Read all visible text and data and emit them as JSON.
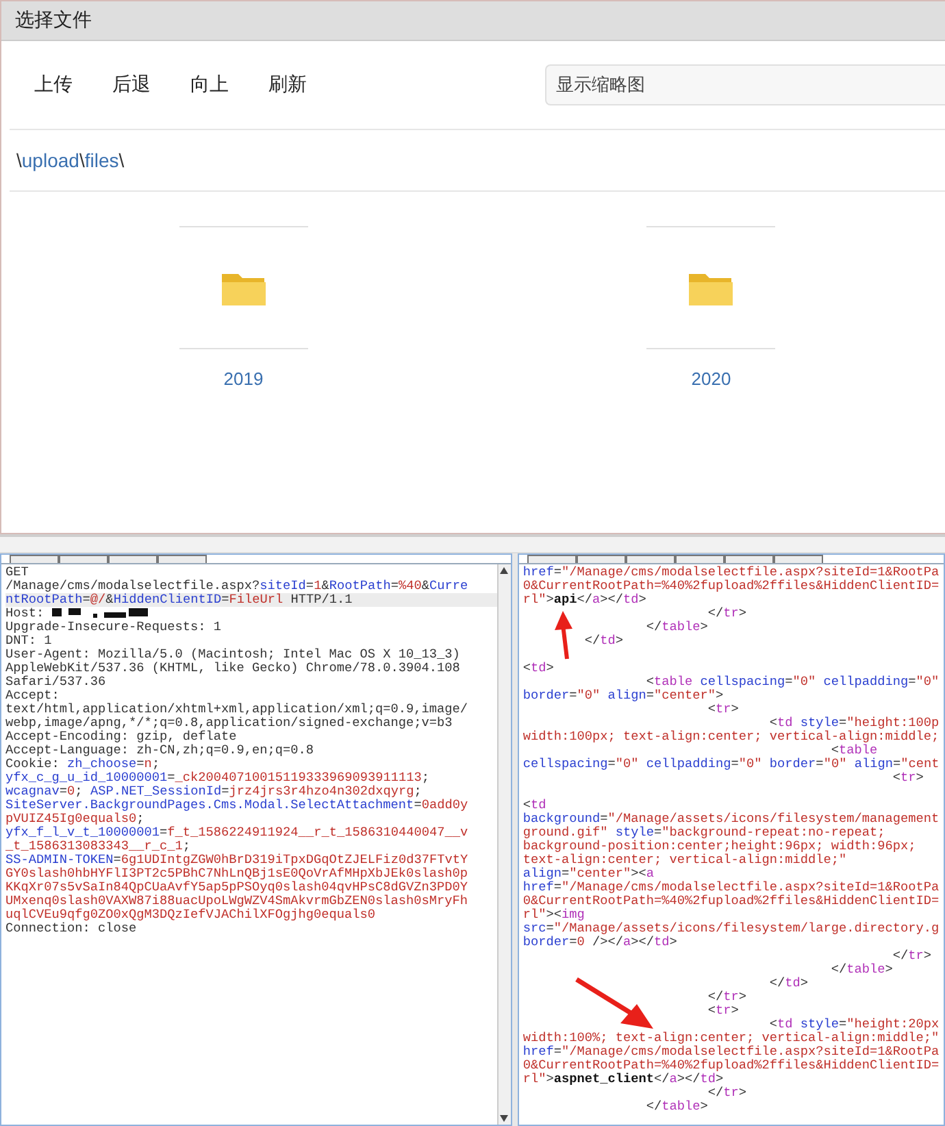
{
  "dialog": {
    "title": "选择文件",
    "toolbar": [
      "上传",
      "后退",
      "向上",
      "刷新"
    ],
    "view_select": {
      "value": "显示缩略图"
    },
    "breadcrumb": [
      {
        "kind": "sep",
        "text": "\\"
      },
      {
        "kind": "link",
        "text": "upload"
      },
      {
        "kind": "sep",
        "text": "\\"
      },
      {
        "kind": "link",
        "text": "files"
      },
      {
        "kind": "sep",
        "text": "\\"
      }
    ],
    "folders": [
      {
        "name": "2019"
      },
      {
        "name": "2020"
      }
    ]
  },
  "request": {
    "lines": [
      {
        "highlighted": false,
        "parts": [
          {
            "kind": "plain",
            "t": "GET"
          }
        ]
      },
      {
        "highlighted": false,
        "parts": [
          {
            "kind": "plain",
            "t": "/Manage/cms/modalselectfile.aspx?"
          },
          {
            "kind": "name",
            "t": "siteId"
          },
          {
            "kind": "plain",
            "t": "="
          },
          {
            "kind": "value",
            "t": "1"
          },
          {
            "kind": "plain",
            "t": "&"
          },
          {
            "kind": "name",
            "t": "RootPath"
          },
          {
            "kind": "plain",
            "t": "="
          },
          {
            "kind": "value",
            "t": "%40"
          },
          {
            "kind": "plain",
            "t": "&"
          },
          {
            "kind": "name",
            "t": "Curre"
          }
        ]
      },
      {
        "highlighted": true,
        "parts": [
          {
            "kind": "name",
            "t": "ntRootPath"
          },
          {
            "kind": "plain",
            "t": "="
          },
          {
            "kind": "value",
            "t": "@/"
          },
          {
            "kind": "plain",
            "t": "&"
          },
          {
            "kind": "name",
            "t": "HiddenClientID"
          },
          {
            "kind": "plain",
            "t": "="
          },
          {
            "kind": "value",
            "t": "FileUrl"
          },
          {
            "kind": "plain",
            "t": " HTTP/1.1"
          }
        ]
      },
      {
        "highlighted": false,
        "parts": [
          {
            "kind": "plain",
            "t": "Host:"
          },
          {
            "kind": "redacted"
          }
        ]
      },
      {
        "highlighted": false,
        "parts": [
          {
            "kind": "plain",
            "t": "Upgrade-Insecure-Requests: 1"
          }
        ]
      },
      {
        "highlighted": false,
        "parts": [
          {
            "kind": "plain",
            "t": "DNT: 1"
          }
        ]
      },
      {
        "highlighted": false,
        "parts": [
          {
            "kind": "plain",
            "t": "User-Agent: Mozilla/5.0 (Macintosh; Intel Mac OS X 10_13_3)"
          }
        ]
      },
      {
        "highlighted": false,
        "parts": [
          {
            "kind": "plain",
            "t": "AppleWebKit/537.36 (KHTML, like Gecko) Chrome/78.0.3904.108"
          }
        ]
      },
      {
        "highlighted": false,
        "parts": [
          {
            "kind": "plain",
            "t": "Safari/537.36"
          }
        ]
      },
      {
        "highlighted": false,
        "parts": [
          {
            "kind": "plain",
            "t": "Accept:"
          }
        ]
      },
      {
        "highlighted": false,
        "parts": [
          {
            "kind": "plain",
            "t": "text/html,application/xhtml+xml,application/xml;q=0.9,image/"
          }
        ]
      },
      {
        "highlighted": false,
        "parts": [
          {
            "kind": "plain",
            "t": "webp,image/apng,*/*;q=0.8,application/signed-exchange;v=b3"
          }
        ]
      },
      {
        "highlighted": false,
        "parts": [
          {
            "kind": "plain",
            "t": "Accept-Encoding: gzip, deflate"
          }
        ]
      },
      {
        "highlighted": false,
        "parts": [
          {
            "kind": "plain",
            "t": "Accept-Language: zh-CN,zh;q=0.9,en;q=0.8"
          }
        ]
      },
      {
        "highlighted": false,
        "parts": [
          {
            "kind": "plain",
            "t": "Cookie: "
          },
          {
            "kind": "name",
            "t": "zh_choose"
          },
          {
            "kind": "plain",
            "t": "="
          },
          {
            "kind": "value",
            "t": "n"
          },
          {
            "kind": "plain",
            "t": ";"
          }
        ]
      },
      {
        "highlighted": false,
        "parts": [
          {
            "kind": "name",
            "t": "yfx_c_g_u_id_10000001"
          },
          {
            "kind": "plain",
            "t": "="
          },
          {
            "kind": "value",
            "t": "_ck20040710015119333969093911113"
          },
          {
            "kind": "plain",
            "t": ";"
          }
        ]
      },
      {
        "highlighted": false,
        "parts": [
          {
            "kind": "name",
            "t": "wcagnav"
          },
          {
            "kind": "plain",
            "t": "="
          },
          {
            "kind": "value",
            "t": "0"
          },
          {
            "kind": "plain",
            "t": "; "
          },
          {
            "kind": "name",
            "t": "ASP.NET_SessionId"
          },
          {
            "kind": "plain",
            "t": "="
          },
          {
            "kind": "value",
            "t": "jrz4jrs3r4hzo4n302dxqyrg"
          },
          {
            "kind": "plain",
            "t": ";"
          }
        ]
      },
      {
        "highlighted": false,
        "parts": [
          {
            "kind": "name",
            "t": "SiteServer.BackgroundPages.Cms.Modal.SelectAttachment"
          },
          {
            "kind": "plain",
            "t": "="
          },
          {
            "kind": "value",
            "t": "0add0y"
          }
        ]
      },
      {
        "highlighted": false,
        "parts": [
          {
            "kind": "value",
            "t": "pVUIZ45Ig0equals0"
          },
          {
            "kind": "plain",
            "t": ";"
          }
        ]
      },
      {
        "highlighted": false,
        "parts": [
          {
            "kind": "name",
            "t": "yfx_f_l_v_t_10000001"
          },
          {
            "kind": "plain",
            "t": "="
          },
          {
            "kind": "value",
            "t": "f_t_1586224911924__r_t_1586310440047__v"
          }
        ]
      },
      {
        "highlighted": false,
        "parts": [
          {
            "kind": "value",
            "t": "_t_1586313083343__r_c_1"
          },
          {
            "kind": "plain",
            "t": ";"
          }
        ]
      },
      {
        "highlighted": false,
        "parts": [
          {
            "kind": "name",
            "t": "SS-ADMIN-TOKEN"
          },
          {
            "kind": "plain",
            "t": "="
          },
          {
            "kind": "value",
            "t": "6g1UDIntgZGW0hBrD319iTpxDGqOtZJELFiz0d37FTvtY"
          }
        ]
      },
      {
        "highlighted": false,
        "parts": [
          {
            "kind": "value",
            "t": "GY0slash0hbHYFlI3PT2c5PBhC7NhLnQBj1sE0QoVrAfMHpXbJEk0slash0p"
          }
        ]
      },
      {
        "highlighted": false,
        "parts": [
          {
            "kind": "value",
            "t": "KKqXr07s5vSaIn84QpCUaAvfY5ap5pPSOyq0slash04qvHPsC8dGVZn3PD0Y"
          }
        ]
      },
      {
        "highlighted": false,
        "parts": [
          {
            "kind": "value",
            "t": "UMxenq0slash0VAXW87i88uacUpoLWgWZV4SmAkvrmGbZEN0slash0sMryFh"
          }
        ]
      },
      {
        "highlighted": false,
        "parts": [
          {
            "kind": "value",
            "t": "uqlCVEu9qfg0ZO0xQgM3DQzIefVJAChilXFOgjhg0equals0"
          }
        ]
      },
      {
        "highlighted": false,
        "parts": [
          {
            "kind": "plain",
            "t": "Connection: close"
          }
        ]
      }
    ]
  },
  "response": {
    "lines": [
      {
        "gap_before": false,
        "parts": [
          {
            "kind": "attr",
            "t": "href"
          },
          {
            "kind": "punct",
            "t": "="
          },
          {
            "kind": "string",
            "t": "\"/Manage/cms/modalselectfile.aspx?siteId=1&RootPa"
          }
        ]
      },
      {
        "gap_before": false,
        "parts": [
          {
            "kind": "string",
            "t": "0&CurrentRootPath=%40%2fupload%2ffiles&HiddenClientID="
          }
        ]
      },
      {
        "gap_before": false,
        "parts": [
          {
            "kind": "string",
            "t": "rl\""
          },
          {
            "kind": "punct",
            "t": ">"
          },
          {
            "kind": "bold",
            "t": "api"
          },
          {
            "kind": "punct",
            "t": "</"
          },
          {
            "kind": "tag",
            "t": "a"
          },
          {
            "kind": "punct",
            "t": "></"
          },
          {
            "kind": "tag",
            "t": "td"
          },
          {
            "kind": "punct",
            "t": ">"
          }
        ]
      },
      {
        "gap_before": false,
        "parts": [
          {
            "kind": "punct",
            "t": "                        </"
          },
          {
            "kind": "tag",
            "t": "tr"
          },
          {
            "kind": "punct",
            "t": ">"
          }
        ]
      },
      {
        "gap_before": false,
        "parts": [
          {
            "kind": "punct",
            "t": "                </"
          },
          {
            "kind": "tag",
            "t": "table"
          },
          {
            "kind": "punct",
            "t": ">"
          }
        ]
      },
      {
        "gap_before": false,
        "parts": [
          {
            "kind": "punct",
            "t": "        </"
          },
          {
            "kind": "tag",
            "t": "td"
          },
          {
            "kind": "punct",
            "t": ">"
          }
        ]
      },
      {
        "gap_before": true,
        "parts": [
          {
            "kind": "punct",
            "t": "<"
          },
          {
            "kind": "tag",
            "t": "td"
          },
          {
            "kind": "punct",
            "t": ">"
          }
        ]
      },
      {
        "gap_before": false,
        "parts": [
          {
            "kind": "punct",
            "t": "                <"
          },
          {
            "kind": "tag",
            "t": "table"
          },
          {
            "kind": "attr",
            "t": " cellspacing"
          },
          {
            "kind": "punct",
            "t": "="
          },
          {
            "kind": "string",
            "t": "\"0\""
          },
          {
            "kind": "attr",
            "t": " cellpadding"
          },
          {
            "kind": "punct",
            "t": "="
          },
          {
            "kind": "string",
            "t": "\"0\""
          }
        ]
      },
      {
        "gap_before": false,
        "parts": [
          {
            "kind": "attr",
            "t": "border"
          },
          {
            "kind": "punct",
            "t": "="
          },
          {
            "kind": "string",
            "t": "\"0\""
          },
          {
            "kind": "attr",
            "t": " align"
          },
          {
            "kind": "punct",
            "t": "="
          },
          {
            "kind": "string",
            "t": "\"center\""
          },
          {
            "kind": "punct",
            "t": ">"
          }
        ]
      },
      {
        "gap_before": false,
        "parts": [
          {
            "kind": "punct",
            "t": "                        <"
          },
          {
            "kind": "tag",
            "t": "tr"
          },
          {
            "kind": "punct",
            "t": ">"
          }
        ]
      },
      {
        "gap_before": false,
        "parts": [
          {
            "kind": "punct",
            "t": "                                <"
          },
          {
            "kind": "tag",
            "t": "td"
          },
          {
            "kind": "attr",
            "t": " style"
          },
          {
            "kind": "punct",
            "t": "="
          },
          {
            "kind": "string",
            "t": "\"height:100p"
          }
        ]
      },
      {
        "gap_before": false,
        "parts": [
          {
            "kind": "string",
            "t": "width:100px; text-align:center; vertical-align:middle;"
          }
        ]
      },
      {
        "gap_before": false,
        "parts": [
          {
            "kind": "punct",
            "t": "                                        <"
          },
          {
            "kind": "tag",
            "t": "table"
          }
        ]
      },
      {
        "gap_before": false,
        "parts": [
          {
            "kind": "attr",
            "t": "cellspacing"
          },
          {
            "kind": "punct",
            "t": "="
          },
          {
            "kind": "string",
            "t": "\"0\""
          },
          {
            "kind": "attr",
            "t": " cellpadding"
          },
          {
            "kind": "punct",
            "t": "="
          },
          {
            "kind": "string",
            "t": "\"0\""
          },
          {
            "kind": "attr",
            "t": " border"
          },
          {
            "kind": "punct",
            "t": "="
          },
          {
            "kind": "string",
            "t": "\"0\""
          },
          {
            "kind": "attr",
            "t": " align"
          },
          {
            "kind": "punct",
            "t": "="
          },
          {
            "kind": "string",
            "t": "\"cent"
          }
        ]
      },
      {
        "gap_before": false,
        "parts": [
          {
            "kind": "punct",
            "t": "                                                <"
          },
          {
            "kind": "tag",
            "t": "tr"
          },
          {
            "kind": "punct",
            "t": ">"
          }
        ]
      },
      {
        "gap_before": true,
        "parts": [
          {
            "kind": "punct",
            "t": "<"
          },
          {
            "kind": "tag",
            "t": "td"
          }
        ]
      },
      {
        "gap_before": false,
        "parts": [
          {
            "kind": "attr",
            "t": "background"
          },
          {
            "kind": "punct",
            "t": "="
          },
          {
            "kind": "string",
            "t": "\"/Manage/assets/icons/filesystem/management"
          }
        ]
      },
      {
        "gap_before": false,
        "parts": [
          {
            "kind": "string",
            "t": "ground.gif\""
          },
          {
            "kind": "attr",
            "t": " style"
          },
          {
            "kind": "punct",
            "t": "="
          },
          {
            "kind": "string",
            "t": "\"background-repeat:no-repeat;"
          }
        ]
      },
      {
        "gap_before": false,
        "parts": [
          {
            "kind": "string",
            "t": "background-position:center;height:96px; width:96px;"
          }
        ]
      },
      {
        "gap_before": false,
        "parts": [
          {
            "kind": "string",
            "t": "text-align:center; vertical-align:middle;\""
          }
        ]
      },
      {
        "gap_before": false,
        "parts": [
          {
            "kind": "attr",
            "t": "align"
          },
          {
            "kind": "punct",
            "t": "="
          },
          {
            "kind": "string",
            "t": "\"center\""
          },
          {
            "kind": "punct",
            "t": "><"
          },
          {
            "kind": "tag",
            "t": "a"
          }
        ]
      },
      {
        "gap_before": false,
        "parts": [
          {
            "kind": "attr",
            "t": "href"
          },
          {
            "kind": "punct",
            "t": "="
          },
          {
            "kind": "string",
            "t": "\"/Manage/cms/modalselectfile.aspx?siteId=1&RootPa"
          }
        ]
      },
      {
        "gap_before": false,
        "parts": [
          {
            "kind": "string",
            "t": "0&CurrentRootPath=%40%2fupload%2ffiles&HiddenClientID="
          }
        ]
      },
      {
        "gap_before": false,
        "parts": [
          {
            "kind": "string",
            "t": "rl\""
          },
          {
            "kind": "punct",
            "t": "><"
          },
          {
            "kind": "tag",
            "t": "img"
          }
        ]
      },
      {
        "gap_before": false,
        "parts": [
          {
            "kind": "attr",
            "t": "src"
          },
          {
            "kind": "punct",
            "t": "="
          },
          {
            "kind": "string",
            "t": "\"/Manage/assets/icons/filesystem/large.directory.g"
          }
        ]
      },
      {
        "gap_before": false,
        "parts": [
          {
            "kind": "attr",
            "t": "border"
          },
          {
            "kind": "punct",
            "t": "="
          },
          {
            "kind": "string",
            "t": "0"
          },
          {
            "kind": "punct",
            "t": " /></"
          },
          {
            "kind": "tag",
            "t": "a"
          },
          {
            "kind": "punct",
            "t": "></"
          },
          {
            "kind": "tag",
            "t": "td"
          },
          {
            "kind": "punct",
            "t": ">"
          }
        ]
      },
      {
        "gap_before": false,
        "parts": [
          {
            "kind": "punct",
            "t": "                                                </"
          },
          {
            "kind": "tag",
            "t": "tr"
          },
          {
            "kind": "punct",
            "t": ">"
          }
        ]
      },
      {
        "gap_before": false,
        "parts": [
          {
            "kind": "punct",
            "t": "                                        </"
          },
          {
            "kind": "tag",
            "t": "table"
          },
          {
            "kind": "punct",
            "t": ">"
          }
        ]
      },
      {
        "gap_before": false,
        "parts": [
          {
            "kind": "punct",
            "t": "                                </"
          },
          {
            "kind": "tag",
            "t": "td"
          },
          {
            "kind": "punct",
            "t": ">"
          }
        ]
      },
      {
        "gap_before": false,
        "parts": [
          {
            "kind": "punct",
            "t": "                        </"
          },
          {
            "kind": "tag",
            "t": "tr"
          },
          {
            "kind": "punct",
            "t": ">"
          }
        ]
      },
      {
        "gap_before": false,
        "parts": [
          {
            "kind": "punct",
            "t": "                        <"
          },
          {
            "kind": "tag",
            "t": "tr"
          },
          {
            "kind": "punct",
            "t": ">"
          }
        ]
      },
      {
        "gap_before": false,
        "parts": [
          {
            "kind": "punct",
            "t": "                                <"
          },
          {
            "kind": "tag",
            "t": "td"
          },
          {
            "kind": "attr",
            "t": " style"
          },
          {
            "kind": "punct",
            "t": "="
          },
          {
            "kind": "string",
            "t": "\"height:20px"
          }
        ]
      },
      {
        "gap_before": false,
        "parts": [
          {
            "kind": "string",
            "t": "width:100%; text-align:center; vertical-align:middle;\""
          }
        ]
      },
      {
        "gap_before": false,
        "parts": [
          {
            "kind": "attr",
            "t": "href"
          },
          {
            "kind": "punct",
            "t": "="
          },
          {
            "kind": "string",
            "t": "\"/Manage/cms/modalselectfile.aspx?siteId=1&RootPa"
          }
        ]
      },
      {
        "gap_before": false,
        "parts": [
          {
            "kind": "string",
            "t": "0&CurrentRootPath=%40%2fupload%2ffiles&HiddenClientID="
          }
        ]
      },
      {
        "gap_before": false,
        "parts": [
          {
            "kind": "string",
            "t": "rl\""
          },
          {
            "kind": "punct",
            "t": ">"
          },
          {
            "kind": "bold",
            "t": "aspnet_client"
          },
          {
            "kind": "punct",
            "t": "</"
          },
          {
            "kind": "tag",
            "t": "a"
          },
          {
            "kind": "punct",
            "t": "></"
          },
          {
            "kind": "tag",
            "t": "td"
          },
          {
            "kind": "punct",
            "t": ">"
          }
        ]
      },
      {
        "gap_before": false,
        "parts": [
          {
            "kind": "punct",
            "t": "                        </"
          },
          {
            "kind": "tag",
            "t": "tr"
          },
          {
            "kind": "punct",
            "t": ">"
          }
        ]
      },
      {
        "gap_before": false,
        "parts": [
          {
            "kind": "punct",
            "t": "                </"
          },
          {
            "kind": "tag",
            "t": "table"
          },
          {
            "kind": "punct",
            "t": ">"
          }
        ]
      }
    ]
  }
}
